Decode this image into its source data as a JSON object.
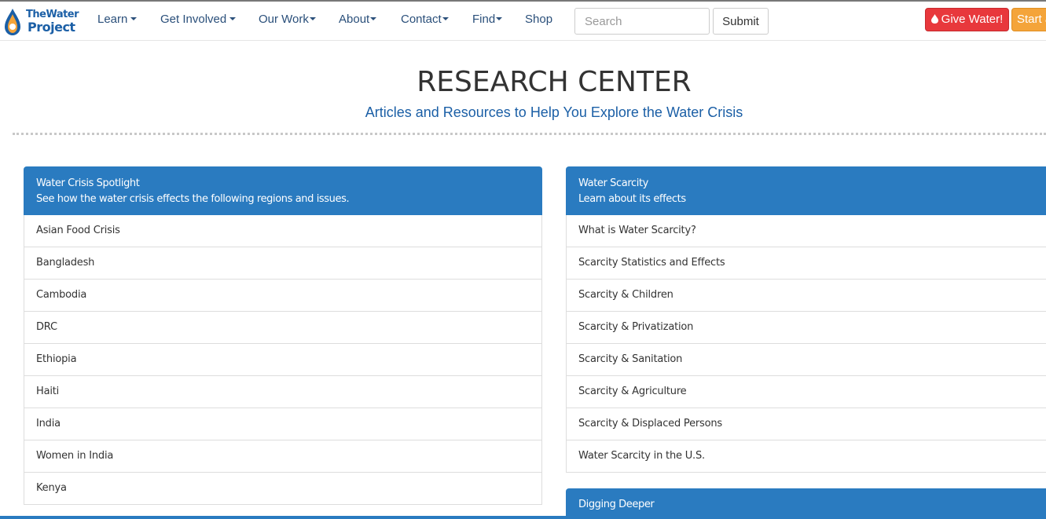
{
  "brand": {
    "logo_line1": "TheWater",
    "logo_line2": "Project"
  },
  "nav": {
    "items": [
      {
        "label": "Learn",
        "dropdown": true
      },
      {
        "label": "Get Involved",
        "dropdown": true
      },
      {
        "label": "Our Work",
        "dropdown": true
      },
      {
        "label": "About",
        "dropdown": true
      },
      {
        "label": "Contact",
        "dropdown": true
      },
      {
        "label": "Find",
        "dropdown": true
      },
      {
        "label": "Shop",
        "dropdown": false
      }
    ]
  },
  "search": {
    "placeholder": "Search",
    "value": "",
    "submit_label": "Submit"
  },
  "cta": {
    "give_label": "Give Water!",
    "start_label": "Start a"
  },
  "header": {
    "title": "RESEARCH CENTER",
    "subtitle": "Articles and Resources to Help You Explore the Water Crisis"
  },
  "panels": {
    "spotlight": {
      "title": "Water Crisis Spotlight",
      "subtitle": "See how the water crisis effects the following regions and issues.",
      "items": [
        "Asian Food Crisis",
        "Bangladesh",
        "Cambodia",
        "DRC",
        "Ethiopia",
        "Haiti",
        "India",
        "Women in India",
        "Kenya"
      ]
    },
    "scarcity": {
      "title": "Water Scarcity",
      "subtitle": "Learn about its effects",
      "items": [
        "What is Water Scarcity?",
        "Scarcity Statistics and Effects",
        "Scarcity & Children",
        "Scarcity & Privatization",
        "Scarcity & Sanitation",
        "Scarcity & Agriculture",
        "Scarcity & Displaced Persons",
        "Water Scarcity in the U.S."
      ]
    },
    "digging": {
      "title": "Digging Deeper"
    }
  },
  "colors": {
    "primary_blue": "#2a7bc0",
    "nav_text": "#2a4f7a",
    "give_red": "#e8383c",
    "start_orange": "#f4a43a",
    "subtitle_blue": "#1b5fa6"
  },
  "icons": {
    "logo": "water-drop-logo-icon",
    "give": "water-drop-icon",
    "dropdown": "caret-down-icon"
  }
}
